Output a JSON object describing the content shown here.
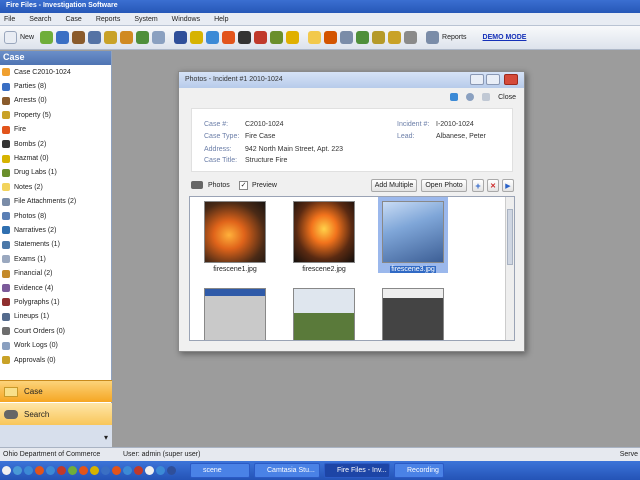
{
  "window": {
    "title": "Fire Files - Investigation Software"
  },
  "menu": [
    "File",
    "Search",
    "Case",
    "Reports",
    "System",
    "Windows",
    "Help"
  ],
  "toolbar": {
    "new_label": "New",
    "reports_label": "Reports",
    "demo_label": "DEMO MODE"
  },
  "sidebar": {
    "header": "Case",
    "items": [
      {
        "label": "Case C2010-1024",
        "icon": "case-icon",
        "color": "#f0a030"
      },
      {
        "label": "Parties (8)",
        "icon": "people-icon",
        "color": "#3a6fc4"
      },
      {
        "label": "Arrests (0)",
        "icon": "arrest-icon",
        "color": "#8a5b2c"
      },
      {
        "label": "Property (5)",
        "icon": "property-icon",
        "color": "#c9a227"
      },
      {
        "label": "Fire",
        "icon": "fire-icon",
        "color": "#e2541b"
      },
      {
        "label": "Bombs (2)",
        "icon": "bomb-icon",
        "color": "#333333"
      },
      {
        "label": "Hazmat (0)",
        "icon": "hazmat-icon",
        "color": "#d6b300"
      },
      {
        "label": "Drug Labs (1)",
        "icon": "drug-lab-icon",
        "color": "#6a8f2b"
      },
      {
        "label": "Notes (2)",
        "icon": "notes-icon",
        "color": "#f2d35c"
      },
      {
        "label": "File Attachments (2)",
        "icon": "attachment-icon",
        "color": "#7a8ca8"
      },
      {
        "label": "Photos (8)",
        "icon": "photo-icon",
        "color": "#5a7fb5"
      },
      {
        "label": "Narratives (2)",
        "icon": "narrative-icon",
        "color": "#2f6fb0"
      },
      {
        "label": "Statements (1)",
        "icon": "statement-icon",
        "color": "#4b78a8"
      },
      {
        "label": "Exams (1)",
        "icon": "exam-icon",
        "color": "#9aa8bf"
      },
      {
        "label": "Financial (2)",
        "icon": "financial-icon",
        "color": "#c48a2a"
      },
      {
        "label": "Evidence (4)",
        "icon": "evidence-icon",
        "color": "#7b5a9a"
      },
      {
        "label": "Polygraphs (1)",
        "icon": "polygraph-icon",
        "color": "#8f2f2f"
      },
      {
        "label": "Lineups (1)",
        "icon": "lineup-icon",
        "color": "#556b8d"
      },
      {
        "label": "Court Orders (0)",
        "icon": "court-order-icon",
        "color": "#6d6d6d"
      },
      {
        "label": "Work Logs (0)",
        "icon": "work-log-icon",
        "color": "#8aa0c0"
      },
      {
        "label": "Approvals (0)",
        "icon": "approval-icon",
        "color": "#c9a227"
      }
    ],
    "nav_case": "Case",
    "nav_search": "Search"
  },
  "dialog": {
    "title": "Photos - Incident #1 2010-1024",
    "close_label": "Close",
    "case_no_label": "Case #:",
    "case_no": "C2010-1024",
    "case_type_label": "Case Type:",
    "case_type": "Fire Case",
    "address_label": "Address:",
    "address": "942 North Main Street, Apt. 223",
    "case_title_label": "Case Title:",
    "case_title": "Structure Fire",
    "incident_label": "Incident #:",
    "incident": "I-2010-1024",
    "lead_label": "Lead:",
    "lead": "Albanese, Peter",
    "photos_label": "Photos",
    "preview_label": "Preview",
    "add_multiple_label": "Add Multiple",
    "open_photo_label": "Open Photo",
    "photos": [
      {
        "caption": "firescene1.jpg",
        "selected": false
      },
      {
        "caption": "firescene2.jpg",
        "selected": false
      },
      {
        "caption": "firescene3.jpg",
        "selected": true
      },
      {
        "caption": "",
        "selected": false
      },
      {
        "caption": "",
        "selected": false
      },
      {
        "caption": "",
        "selected": false
      }
    ]
  },
  "status": {
    "org": "Ohio Department of Commerce",
    "user": "User: admin (super user)",
    "right": "Serve"
  },
  "taskbar": {
    "tasks": [
      "scene",
      "Camtasia Stu...",
      "Fire Files - Inv...",
      "Recording"
    ]
  }
}
